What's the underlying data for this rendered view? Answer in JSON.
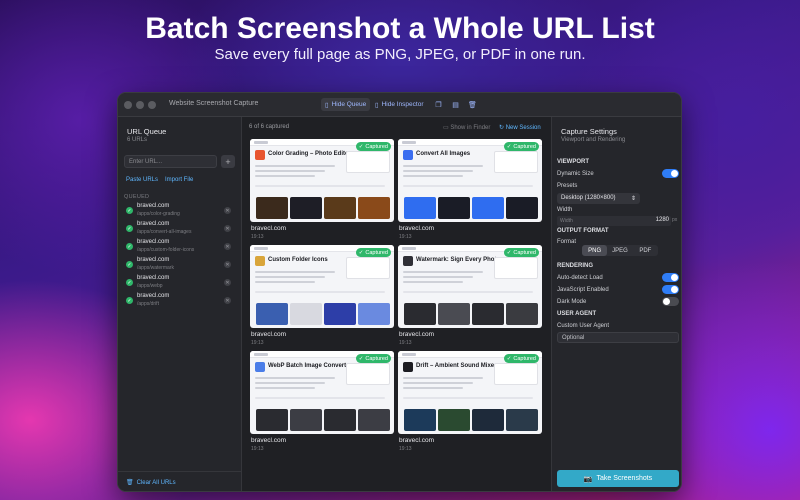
{
  "hero": {
    "title": "Batch Screenshot a Whole URL List",
    "subtitle": "Save every full page as PNG, JPEG, or PDF in one run."
  },
  "window": {
    "title": "Website Screenshot Capture",
    "toolbar": {
      "hide_queue": "Hide Queue",
      "hide_inspector": "Hide Inspector"
    }
  },
  "queue": {
    "title": "URL Queue",
    "count": "6 URLs",
    "input_placeholder": "Enter URL...",
    "add_symbol": "+",
    "paste_urls": "Paste URLs",
    "import_file": "Import File",
    "queued_label": "QUEUED",
    "items": [
      {
        "host": "bravecl.com",
        "path": "/apps/color-grading"
      },
      {
        "host": "bravecl.com",
        "path": "/apps/convert-all-images"
      },
      {
        "host": "bravecl.com",
        "path": "/apps/custom-folder-icons"
      },
      {
        "host": "bravecl.com",
        "path": "/apps/watermark"
      },
      {
        "host": "bravecl.com",
        "path": "/apps/webp"
      },
      {
        "host": "bravecl.com",
        "path": "/apps/drift"
      }
    ],
    "clear_all": "Clear All URLs"
  },
  "gallery": {
    "count": "6 of 6 captured",
    "show_in_finder": "Show in Finder",
    "new_session": "New Session",
    "badge": "Captured",
    "cards": [
      {
        "title": "Color Grading – Photo Editor",
        "host": "bravecl.com",
        "time": "19:13",
        "icon_color": "#e8552f"
      },
      {
        "title": "Convert All Images",
        "host": "bravecl.com",
        "time": "19:13",
        "icon_color": "#3a6df0"
      },
      {
        "title": "Custom Folder Icons",
        "host": "bravecl.com",
        "time": "19:13",
        "icon_color": "#d9a53a"
      },
      {
        "title": "Watermark: Sign Every Photo",
        "host": "bravecl.com",
        "time": "19:13",
        "icon_color": "#2f2f36"
      },
      {
        "title": "WebP Batch Image Converter",
        "host": "bravecl.com",
        "time": "19:13",
        "icon_color": "#4a7de8"
      },
      {
        "title": "Drift – Ambient Sound Mixer",
        "host": "bravecl.com",
        "time": "19:13",
        "icon_color": "#1c1c22"
      }
    ]
  },
  "inspector": {
    "title": "Capture Settings",
    "subtitle": "Viewport and Rendering",
    "viewport_section": "VIEWPORT",
    "dynamic_size": "Dynamic Size",
    "dynamic_size_on": true,
    "presets_label": "Presets",
    "preset_value": "Desktop (1280×800)",
    "width_label": "Width",
    "width_field_label": "Width",
    "width_value": "1280",
    "width_unit": "px",
    "output_section": "OUTPUT FORMAT",
    "format_label": "Format",
    "formats": [
      "PNG",
      "JPEG",
      "PDF"
    ],
    "selected_format": "PNG",
    "rendering_section": "RENDERING",
    "auto_detect": "Auto-detect Load",
    "auto_detect_on": true,
    "javascript": "JavaScript Enabled",
    "javascript_on": true,
    "dark_mode": "Dark Mode",
    "dark_mode_on": false,
    "ua_section": "USER AGENT",
    "custom_ua_label": "Custom User Agent",
    "ua_placeholder": "Optional",
    "take_button": "Take Screenshots"
  },
  "colors": {
    "accent": "#2f7df6",
    "captured_green": "#2fb76a",
    "take_button": "#33a9c8",
    "link_blue": "#5fb7ff"
  }
}
